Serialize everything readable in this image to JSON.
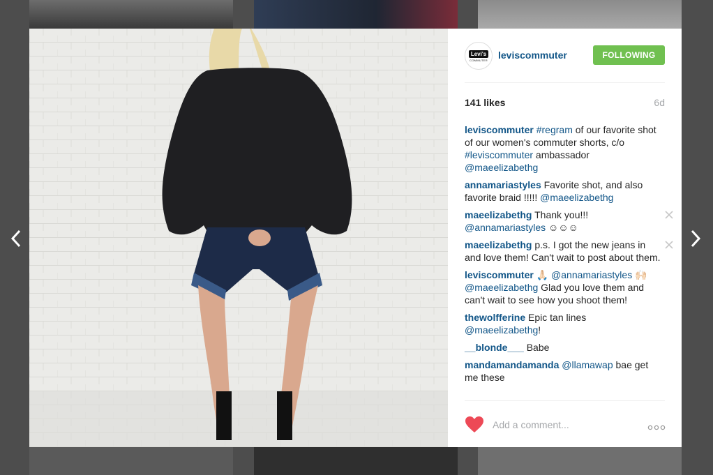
{
  "post": {
    "username": "leviscommuter",
    "follow_label": "FOLLOWING",
    "avatar_logo_text": "Levi's",
    "avatar_sub_text": "COMMUTER",
    "likes": "141 likes",
    "time": "6d"
  },
  "comments": [
    {
      "parts": [
        {
          "type": "user",
          "text": "leviscommuter"
        },
        {
          "type": "text",
          "text": " "
        },
        {
          "type": "link",
          "text": "#regram"
        },
        {
          "type": "text",
          "text": " of our favorite shot of our women's commuter shorts, c/o "
        },
        {
          "type": "link",
          "text": "#leviscommuter"
        },
        {
          "type": "text",
          "text": " ambassador "
        },
        {
          "type": "link",
          "text": "@maeelizabethg"
        }
      ],
      "deletable": false
    },
    {
      "parts": [
        {
          "type": "user",
          "text": "annamariastyles"
        },
        {
          "type": "text",
          "text": " Favorite shot, and also favorite braid !!!!! "
        },
        {
          "type": "link",
          "text": "@maeelizabethg"
        }
      ],
      "deletable": false
    },
    {
      "parts": [
        {
          "type": "user",
          "text": "maeelizabethg"
        },
        {
          "type": "text",
          "text": " Thank you!!! "
        },
        {
          "type": "link",
          "text": "@annamariastyles"
        },
        {
          "type": "text",
          "text": " ☺☺☺"
        }
      ],
      "deletable": true
    },
    {
      "parts": [
        {
          "type": "user",
          "text": "maeelizabethg"
        },
        {
          "type": "text",
          "text": " p.s. I got the new jeans in and love them! Can't wait to post about them."
        }
      ],
      "deletable": true
    },
    {
      "parts": [
        {
          "type": "user",
          "text": "leviscommuter"
        },
        {
          "type": "text",
          "text": " 🙏🏻 "
        },
        {
          "type": "link",
          "text": "@annamariastyles"
        },
        {
          "type": "text",
          "text": " 🙌🏻 "
        },
        {
          "type": "link",
          "text": "@maeelizabethg"
        },
        {
          "type": "text",
          "text": " Glad you love them and can't wait to see how you shoot them!"
        }
      ],
      "deletable": false
    },
    {
      "parts": [
        {
          "type": "user",
          "text": "thewolfferine"
        },
        {
          "type": "text",
          "text": " Epic tan lines "
        },
        {
          "type": "link",
          "text": "@maeelizabethg"
        },
        {
          "type": "text",
          "text": "!"
        }
      ],
      "deletable": false
    },
    {
      "parts": [
        {
          "type": "user",
          "text": "__blonde___"
        },
        {
          "type": "text",
          "text": " Babe"
        }
      ],
      "deletable": false
    },
    {
      "parts": [
        {
          "type": "user",
          "text": "mandamandamanda"
        },
        {
          "type": "text",
          "text": " "
        },
        {
          "type": "link",
          "text": "@llamawap"
        },
        {
          "type": "text",
          "text": " bae get me these"
        }
      ],
      "deletable": false
    }
  ],
  "footer": {
    "comment_placeholder": "Add a comment..."
  },
  "colors": {
    "link": "#125688",
    "follow_button": "#70c050",
    "heart": "#ed4956",
    "muted": "#a5a7aa"
  },
  "icons": {
    "prev": "chevron-left-icon",
    "next": "chevron-right-icon",
    "like": "heart-icon",
    "delete": "close-icon",
    "more": "more-options-icon"
  }
}
